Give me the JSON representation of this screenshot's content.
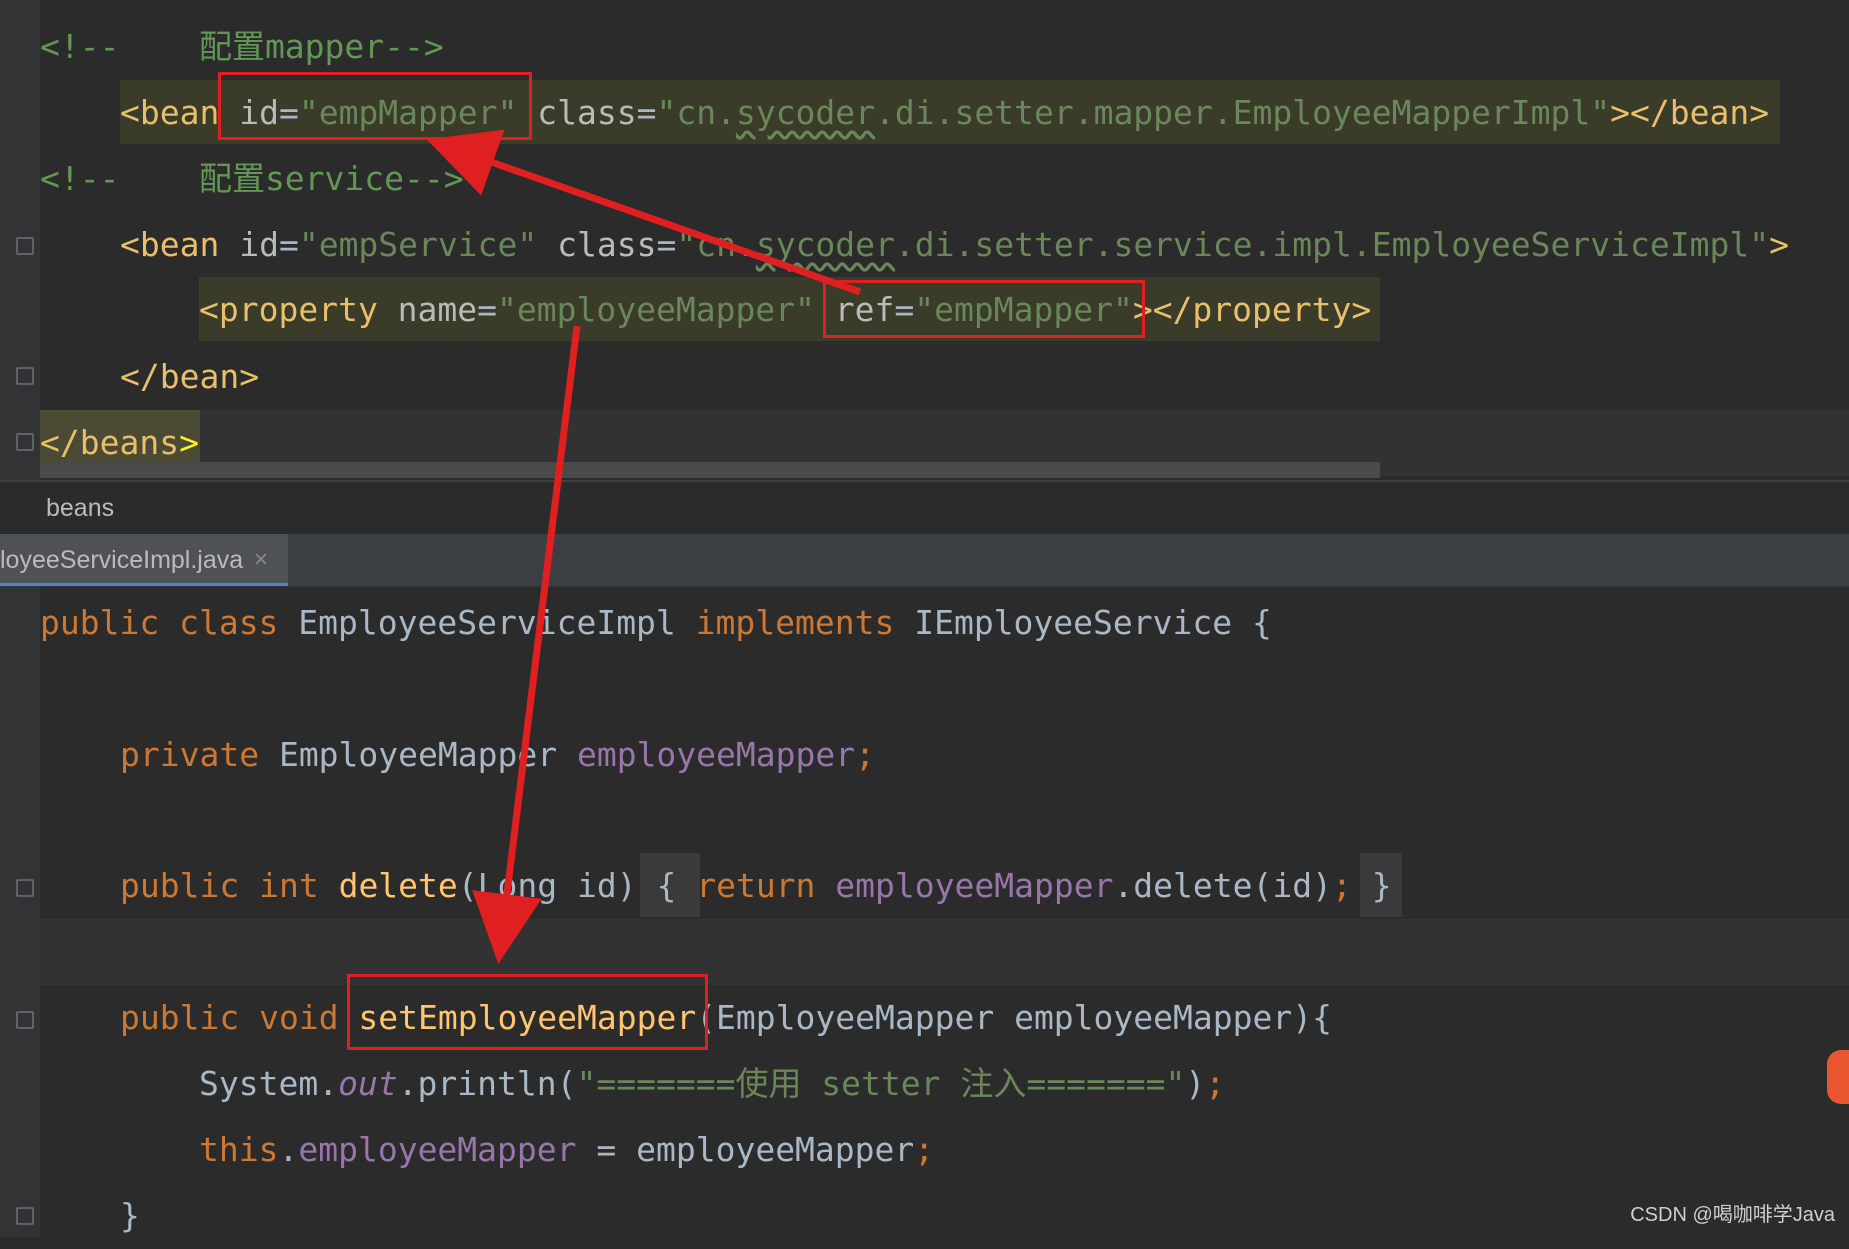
{
  "xml": {
    "comment1": "<!--    配置mapper-->",
    "bean1_open": "<bean",
    "bean1_id_attr": " id",
    "bean1_id_eq": "=",
    "bean1_id_val": "\"empMapper\"",
    "bean1_class_attr": " class",
    "bean1_class_eq": "=",
    "bean1_class_val_a": "\"cn.",
    "bean1_class_val_b": "sycoder",
    "bean1_class_val_c": ".di.setter.mapper.EmployeeMapperImpl\"",
    "bean1_close": "></bean>",
    "comment2": "<!--    配置service-->",
    "bean2_open": "<bean",
    "bean2_id_attr": " id",
    "bean2_id_eq": "=",
    "bean2_id_val": "\"empService\"",
    "bean2_class_attr": " class",
    "bean2_class_eq": "=",
    "bean2_class_val_a": "\"cn.",
    "bean2_class_val_b": "sycoder",
    "bean2_class_val_c": ".di.setter.service.impl.EmployeeServiceImpl\"",
    "bean2_gt": ">",
    "prop_open": "<property",
    "prop_name_attr": " name",
    "prop_name_eq": "=",
    "prop_name_val": "\"employeeMapper\"",
    "prop_ref_attr": " ref",
    "prop_ref_eq": "=",
    "prop_ref_val": "\"empMapper\"",
    "prop_close": "></property>",
    "bean_end": "</bean>",
    "beans_end_a": "</beans",
    "beans_end_b": ">"
  },
  "breadcrumb": "beans",
  "tab": {
    "label": "loyeeServiceImpl.java",
    "close": "×"
  },
  "java": {
    "l1_kw1": "public",
    "l1_kw2": " class",
    "l1_name": " EmployeeServiceImpl",
    "l1_kw3": " implements",
    "l1_iface": " IEmployeeService {",
    "l2_kw": "private",
    "l2_type": " EmployeeMapper",
    "l2_field": " employeeMapper",
    "l2_semi": ";",
    "l3_kw1": "public",
    "l3_kw2": " int",
    "l3_method": " delete",
    "l3_params": "(Long id)",
    "l3_brace_open": " {",
    "l3_kw3": " return",
    "l3_field": " employeeMapper",
    "l3_call": ".delete(id)",
    "l3_semi": ";",
    "l3_brace_close": " }",
    "l4_kw1": "public",
    "l4_kw2": " void",
    "l4_method": " setEmployeeMapper",
    "l4_params": "(EmployeeMapper employeeMapper){",
    "l5_sys": "System.",
    "l5_out": "out",
    "l5_println": ".println(",
    "l5_str": "\"=======使用 setter 注入=======\"",
    "l5_end": ")",
    "l5_semi": ";",
    "l6_this": "this",
    "l6_dot": ".",
    "l6_field": "employeeMapper",
    "l6_rest": " = employeeMapper",
    "l6_semi": ";",
    "l7_brace": "}"
  },
  "watermark": "CSDN @喝咖啡学Java",
  "colors": {
    "background": "#2b2b2b",
    "annotation_red": "#e02020",
    "tag": "#e8bf6a",
    "string": "#6a8759",
    "keyword": "#cc7832"
  }
}
